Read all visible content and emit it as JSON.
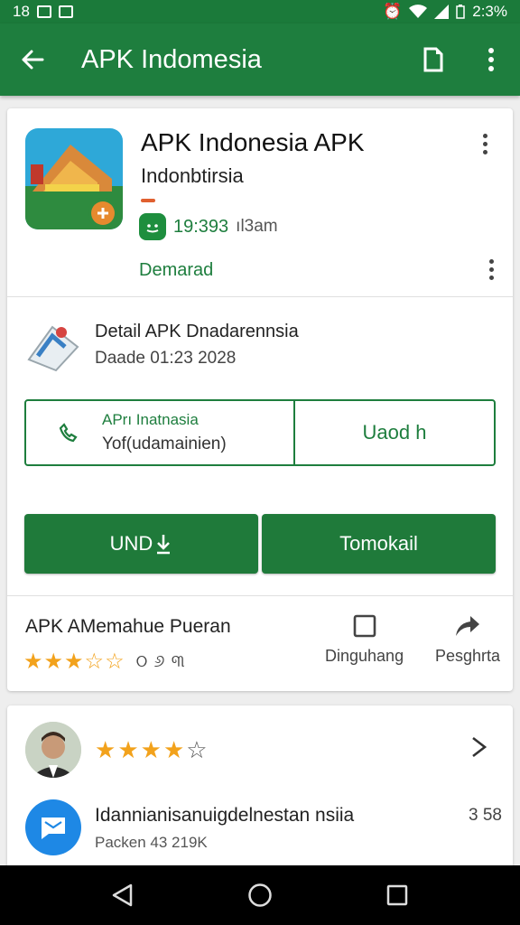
{
  "status_bar": {
    "time_left": "18",
    "time_right": "2:3%"
  },
  "app_bar": {
    "title": "APK Indomesia",
    "back_icon": "arrow-back-icon",
    "save_icon": "document-icon",
    "more_icon": "more-vert-icon"
  },
  "app": {
    "name": "APK  Indonesia APK",
    "developer": "Indonbtirsia",
    "count": "19:393",
    "size": "ıl3am",
    "install_label": "Demarad"
  },
  "detail": {
    "title": "Detail  APK Dnadarennsia",
    "date": "Daade 01:23 2028"
  },
  "split": {
    "top_text": "APrı Inatnasia",
    "bottom_text": "Yof(udamainien)",
    "right_text": "Uaod  h"
  },
  "buttons": {
    "primary_left": "UND",
    "primary_right": "Tomokail"
  },
  "footer": {
    "title": "APK  AMemahue Pueran",
    "stars_filled": 3,
    "stars_total": 5,
    "extra": "ଠ ୬ ୩",
    "action_a": "Dinguhang",
    "action_b": "Pesghrta"
  },
  "review": {
    "stars_filled": 3.5,
    "stars_total": 5
  },
  "list_item": {
    "title": "Idannianisanuigdelnestan nsiia",
    "subtitle": "Packen 43 219K",
    "count": "3 58"
  },
  "colors": {
    "primary": "#1e7e3e",
    "accent_star": "#f2a21c",
    "chip_blue": "#1e88e5"
  }
}
